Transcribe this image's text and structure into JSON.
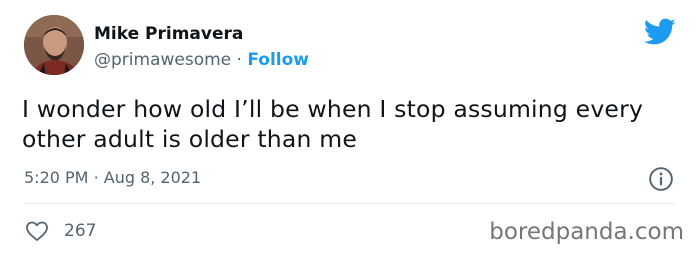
{
  "author": {
    "name": "Mike Primavera",
    "handle": "@primawesome",
    "separator": "·",
    "follow_label": "Follow",
    "avatar_icon": "profile-photo"
  },
  "tweet": {
    "text": "I wonder how old I’ll be when I stop assuming every other adult is older than me",
    "time": "5:20 PM",
    "separator": "·",
    "date": "Aug 8, 2021"
  },
  "actions": {
    "likes": "267",
    "like_icon": "heart-outline",
    "info_icon": "info-circle"
  },
  "brand": {
    "logo_icon": "twitter-bird",
    "accent_color": "#1d9bf0"
  },
  "watermark": "boredpanda.com"
}
